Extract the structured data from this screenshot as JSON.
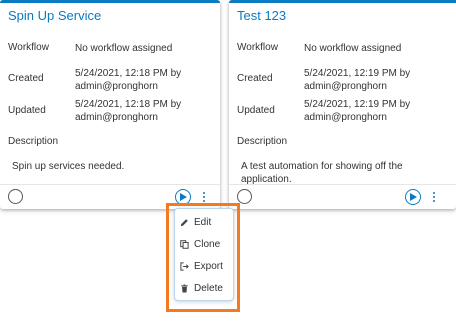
{
  "cards": [
    {
      "title": "Spin Up Service",
      "workflow_label": "Workflow",
      "workflow_value": "No workflow assigned",
      "created_label": "Created",
      "created_line1": "5/24/2021, 12:18 PM by",
      "created_line2": "admin@pronghorn",
      "updated_label": "Updated",
      "updated_line1": "5/24/2021, 12:18 PM by",
      "updated_line2": "admin@pronghorn",
      "description_label": "Description",
      "description_line1": "Spin up services needed.",
      "description_line2": ""
    },
    {
      "title": "Test 123",
      "workflow_label": "Workflow",
      "workflow_value": "No workflow assigned",
      "created_label": "Created",
      "created_line1": "5/24/2021, 12:19 PM by",
      "created_line2": "admin@pronghorn",
      "updated_label": "Updated",
      "updated_line1": "5/24/2021, 12:19 PM by",
      "updated_line2": "admin@pronghorn",
      "description_label": "Description",
      "description_line1": "A test automation for showing off the",
      "description_line2": "application."
    }
  ],
  "context_menu": {
    "items": [
      {
        "label": "Edit",
        "icon": "pencil-icon"
      },
      {
        "label": "Clone",
        "icon": "copy-icon"
      },
      {
        "label": "Export",
        "icon": "export-icon"
      },
      {
        "label": "Delete",
        "icon": "trash-icon"
      }
    ]
  },
  "colors": {
    "accent": "#0a7bc2",
    "highlight": "#f47a20"
  }
}
